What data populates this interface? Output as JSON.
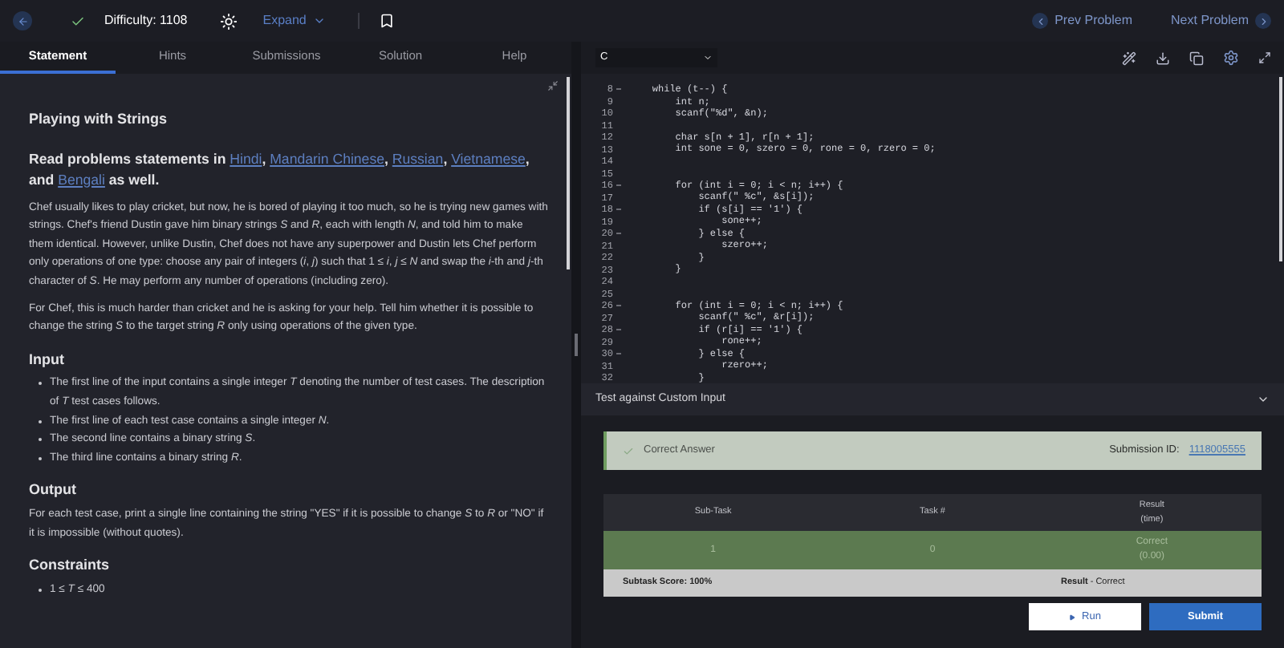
{
  "topbar": {
    "difficulty": "Difficulty: 1108",
    "expand": "Expand",
    "prev": "Prev Problem",
    "next": "Next Problem"
  },
  "tabs": [
    {
      "label": "Statement",
      "selected": true
    },
    {
      "label": "Hints",
      "selected": false
    },
    {
      "label": "Submissions",
      "selected": false
    },
    {
      "label": "Solution",
      "selected": false
    },
    {
      "label": "Help",
      "selected": false
    }
  ],
  "statement": {
    "title": "Playing with Strings",
    "intro": [
      {
        "kind": "text",
        "text": "Read problems statements in "
      },
      {
        "kind": "link",
        "text": "Hindi"
      },
      {
        "kind": "text",
        "text": ", "
      },
      {
        "kind": "link",
        "text": "Mandarin Chinese"
      },
      {
        "kind": "text",
        "text": ", "
      },
      {
        "kind": "link",
        "text": "Russian"
      },
      {
        "kind": "text",
        "text": ", "
      },
      {
        "kind": "link",
        "text": "Vietnamese"
      },
      {
        "kind": "text",
        "text": ", and "
      },
      {
        "kind": "link",
        "text": "Bengali"
      },
      {
        "kind": "text",
        "text": " as well."
      }
    ],
    "paragraphs": [
      "Chef usually likes to play cricket, but now, he is bored of playing it too much, so he is trying new games with strings. Chef's friend Dustin gave him binary strings *S* and *R*, each with length *N*, and told him to make them identical. However, unlike Dustin, Chef does not have any superpower and Dustin lets Chef perform only operations of one type: choose any pair of integers (*i*, *j*) such that 1 ≤ *i*, *j* ≤ *N* and swap the *i*-th and *j*-th character of *S*. He may perform any number of operations (including zero).",
      "For Chef, this is much harder than cricket and he is asking for your help. Tell him whether it is possible to change the string *S* to the target string *R* only using operations of the given type."
    ],
    "sections": [
      {
        "heading": "Input",
        "kind": "list",
        "items": [
          "The first line of the input contains a single integer *T* denoting the number of test cases. The description of *T* test cases follows.",
          "The first line of each test case contains a single integer *N*.",
          "The second line contains a binary string *S*.",
          "The third line contains a binary string *R*."
        ]
      },
      {
        "heading": "Output",
        "kind": "paragraph",
        "text": "For each test case, print a single line containing the string \"YES\" if it is possible to change *S* to *R* or \"NO\" if it is impossible (without quotes)."
      },
      {
        "heading": "Constraints",
        "kind": "list",
        "items": [
          "1 ≤ *T* ≤ 400"
        ]
      }
    ]
  },
  "editor": {
    "language": "C",
    "lines": [
      {
        "no": "8",
        "fold": true,
        "code": "    while (t--) {"
      },
      {
        "no": "9",
        "fold": false,
        "code": "        int n;"
      },
      {
        "no": "10",
        "fold": false,
        "code": "        scanf(\"%d\", &n);"
      },
      {
        "no": "11",
        "fold": false
      },
      {
        "no": "12",
        "fold": false,
        "code": "        char s[n + 1], r[n + 1];"
      },
      {
        "no": "13",
        "fold": false,
        "code": "        int sone = 0, szero = 0, rone = 0, rzero = 0;"
      },
      {
        "no": "14",
        "fold": false
      },
      {
        "no": "15",
        "fold": false
      },
      {
        "no": "16",
        "fold": true,
        "code": "        for (int i = 0; i < n; i++) {"
      },
      {
        "no": "17",
        "fold": false,
        "code": "            scanf(\" %c\", &s[i]);"
      },
      {
        "no": "18",
        "fold": true,
        "code": "            if (s[i] == '1') {"
      },
      {
        "no": "19",
        "fold": false,
        "code": "                sone++;"
      },
      {
        "no": "20",
        "fold": true,
        "code": "            } else {"
      },
      {
        "no": "21",
        "fold": false,
        "code": "                szero++;"
      },
      {
        "no": "22",
        "fold": false,
        "code": "            }"
      },
      {
        "no": "23",
        "fold": false,
        "code": "        }"
      },
      {
        "no": "24",
        "fold": false
      },
      {
        "no": "25",
        "fold": false
      },
      {
        "no": "26",
        "fold": true,
        "code": "        for (int i = 0; i < n; i++) {"
      },
      {
        "no": "27",
        "fold": false,
        "code": "            scanf(\" %c\", &r[i]);"
      },
      {
        "no": "28",
        "fold": true,
        "code": "            if (r[i] == '1') {"
      },
      {
        "no": "29",
        "fold": false,
        "code": "                rone++;"
      },
      {
        "no": "30",
        "fold": true,
        "code": "            } else {"
      },
      {
        "no": "31",
        "fold": false,
        "code": "                rzero++;"
      },
      {
        "no": "32",
        "fold": false,
        "code": "            }"
      }
    ]
  },
  "custom_input": {
    "title": "Test against Custom Input"
  },
  "result": {
    "verdict": "Correct Answer",
    "submission_label": "Submission ID:",
    "submission_id": "1118005555",
    "columns": [
      {
        "label": "Sub-Task"
      },
      {
        "label": "Task #"
      },
      {
        "label": "Result",
        "sub": "(time)"
      }
    ],
    "rows": [
      {
        "subtask": "1",
        "task": "0",
        "result": "Correct",
        "time": "(0.00)"
      }
    ],
    "score": "Subtask Score: 100%",
    "summary": "**Result** - Correct"
  },
  "buttons": {
    "run": "Run",
    "submit": "Submit"
  }
}
